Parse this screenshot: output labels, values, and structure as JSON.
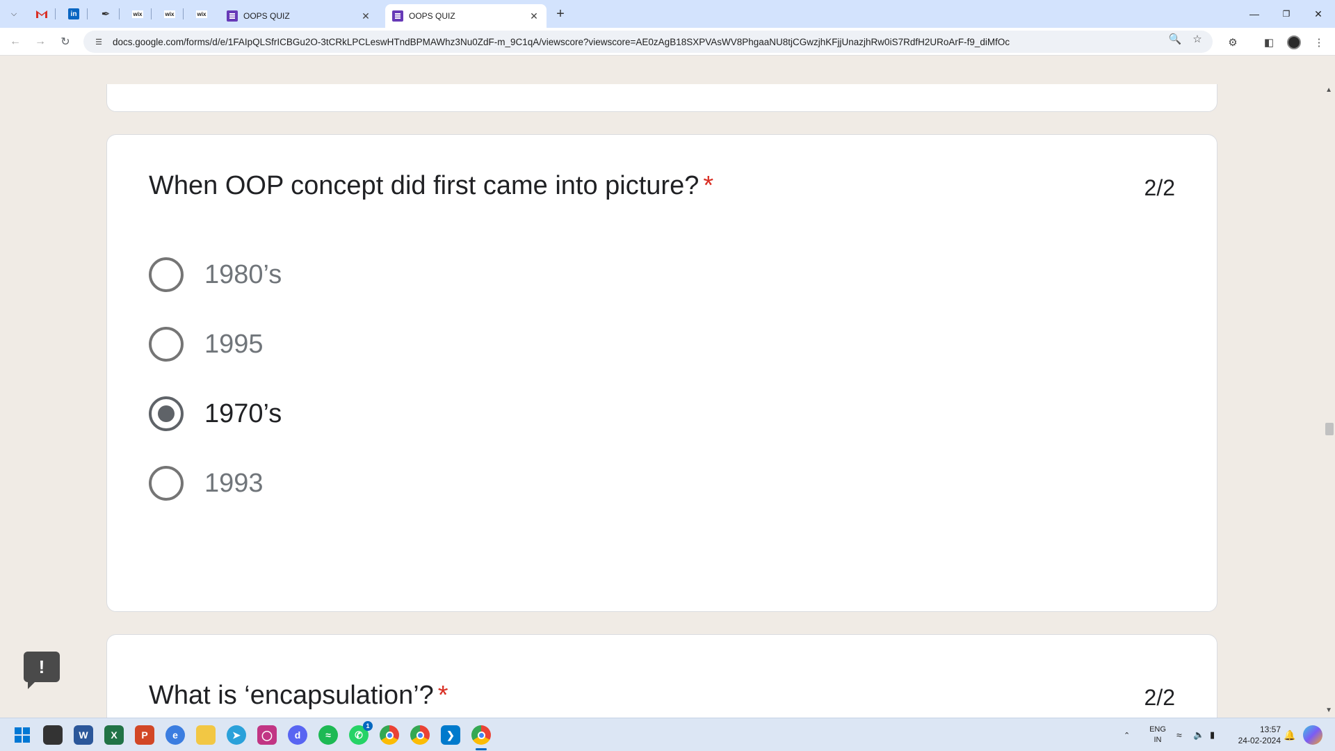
{
  "browser": {
    "tabs": [
      {
        "title": "OOPS QUIZ",
        "active": false
      },
      {
        "title": "OOPS QUIZ",
        "active": true
      }
    ],
    "pinned_tabs": [
      "gmail-icon",
      "linkedin-icon",
      "pen-icon",
      "wix-icon",
      "wix-icon",
      "wix-icon"
    ],
    "pinned_labels": {
      "wix1": "wix",
      "wix2": "wix",
      "wix3": "wix"
    },
    "url": "docs.google.com/forms/d/e/1FAIpQLSfrICBGu2O-3tCRkLPCLeswHTndBPMAWhz3Nu0ZdF-m_9C1qA/viewscore?viewscore=AE0zAgB18SXPVAsWV8PhgaaNU8tjCGwzjhKFjjUnazjhRw0iS7RdfH2URoArF-f9_diMfOc"
  },
  "questions": [
    {
      "text": "When OOP concept did first came into picture?",
      "required_mark": "*",
      "score": "2/2",
      "options": [
        {
          "label": "1980’s",
          "selected": false
        },
        {
          "label": "1995",
          "selected": false
        },
        {
          "label": "1970’s",
          "selected": true
        },
        {
          "label": "1993",
          "selected": false
        }
      ]
    },
    {
      "text": "What is ‘encapsulation’?",
      "required_mark": "*",
      "score": "2/2"
    }
  ],
  "feedback_label": "!",
  "taskbar": {
    "apps": [
      "windows-start-icon",
      "file-icon",
      "word-icon",
      "excel-icon",
      "powerpoint-icon",
      "edge-icon",
      "file-explorer-icon",
      "telegram-icon",
      "instagram-icon",
      "discord-icon",
      "spotify-icon",
      "whatsapp-icon",
      "chrome-icon",
      "chrome-profile-icon",
      "vscode-icon",
      "chrome-active-icon"
    ],
    "whatsapp_badge": "1",
    "language": "ENG",
    "region": "IN",
    "time": "13:57",
    "date": "24-02-2024"
  },
  "colors": {
    "tabstrip": "#d3e3fd",
    "page_bg": "#f0ebe5",
    "required": "#d93025",
    "forms_purple": "#673ab7"
  }
}
